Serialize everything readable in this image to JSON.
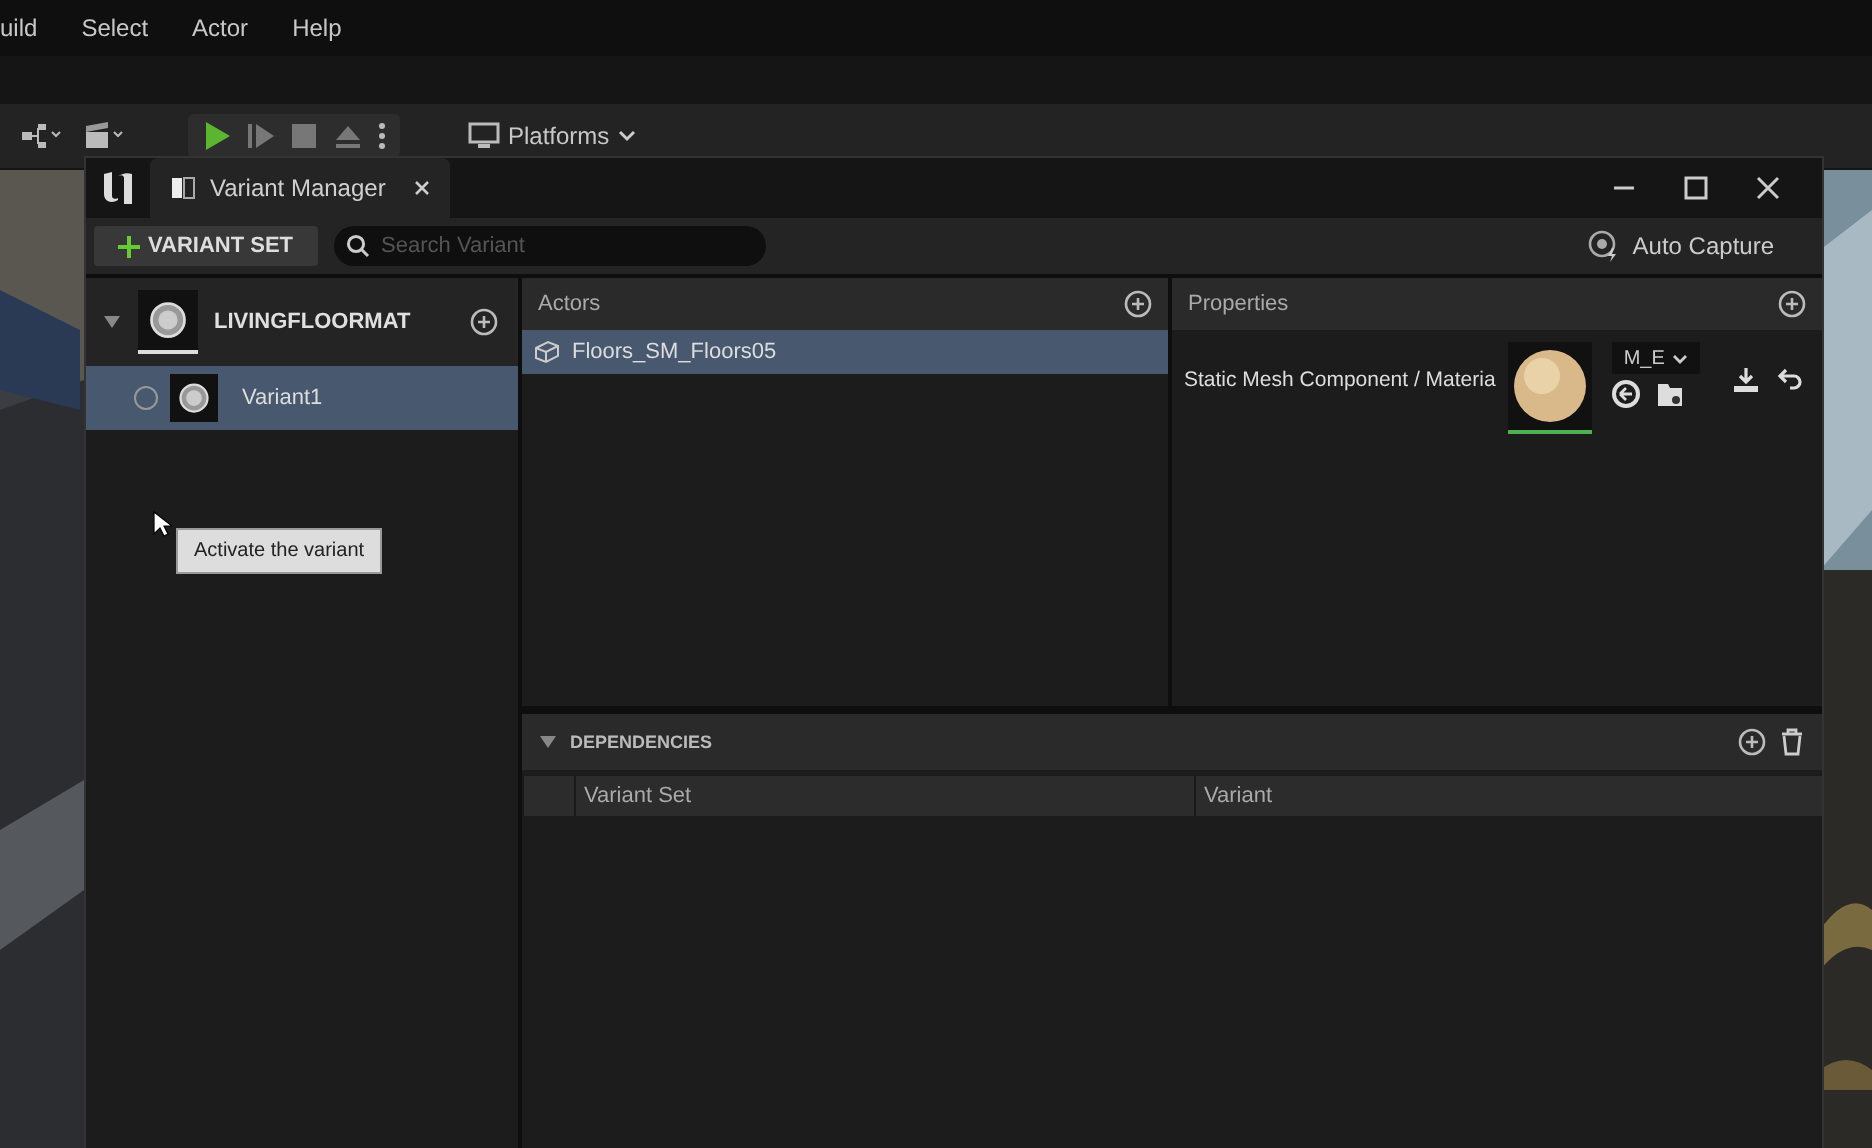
{
  "menu": [
    "uild",
    "Select",
    "Actor",
    "Help"
  ],
  "toolbar": {
    "platforms": "Platforms"
  },
  "window": {
    "title": "Variant Manager",
    "add_button": "VARIANT SET",
    "search": {
      "placeholder": "Search Variant"
    },
    "auto_capture": "Auto Capture"
  },
  "variant_sets": [
    {
      "name": "LIVINGFLOORMAT",
      "expanded": true,
      "variants": [
        {
          "name": "Variant1",
          "selected": true,
          "active": false
        }
      ]
    }
  ],
  "tooltip": "Activate the variant",
  "actors": {
    "title": "Actors",
    "items": [
      {
        "name": "Floors_SM_Floors05",
        "selected": true
      }
    ]
  },
  "properties": {
    "title": "Properties",
    "rows": [
      {
        "label": "Static Mesh Component / Materia",
        "value": "M_E"
      }
    ]
  },
  "dependencies": {
    "title": "DEPENDENCIES",
    "expanded": true,
    "columns": [
      "Variant Set",
      "Variant"
    ]
  }
}
